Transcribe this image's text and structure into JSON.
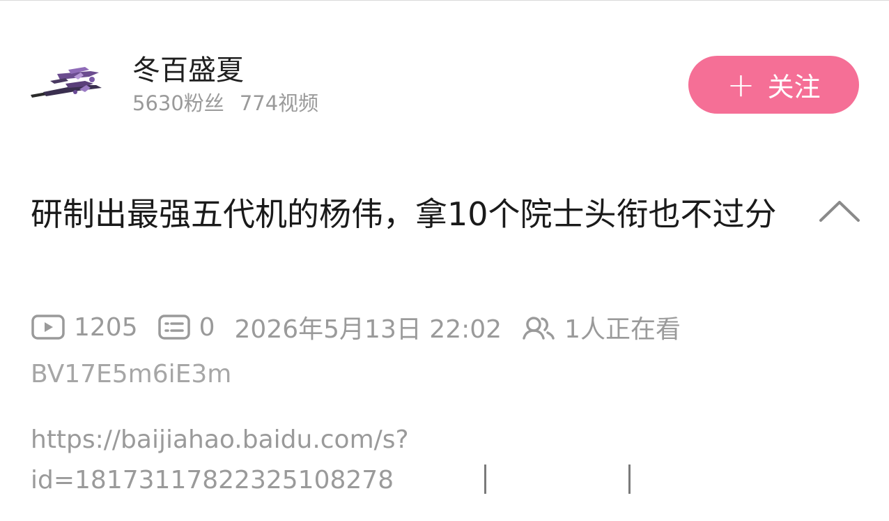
{
  "author": {
    "name": "冬百盛夏",
    "fans": "5630粉丝",
    "videos": "774视频",
    "avatar_icon": "fighter-jets-avatar"
  },
  "follow_button": {
    "plus": "+",
    "label": "关注",
    "color": "#f56f96"
  },
  "video": {
    "title": "研制出最强五代机的杨伟，拿10个院士头衔也不过分",
    "views": "1205",
    "comments": "0",
    "datetime": "2026年5月13日 22:02",
    "watching": "1人正在看",
    "bvid": "BV17E5m6iE3m",
    "description_line1": "https://baijiahao.baidu.com/s?",
    "description_line2": "id=18173117822325108278"
  },
  "icons": {
    "play": "play-count-icon",
    "comment": "comment-count-icon",
    "viewers": "viewers-icon",
    "collapse": "chevron-up-icon"
  }
}
